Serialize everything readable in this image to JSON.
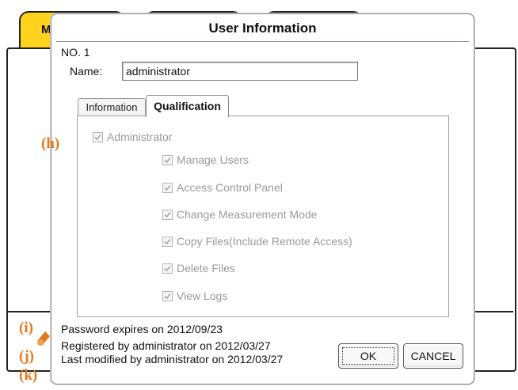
{
  "background": {
    "tabs": [
      {
        "label": "M",
        "color": "#ffd21e"
      },
      {
        "label": "",
        "color": "#c9ed1e"
      },
      {
        "label": "",
        "color": "#ffffff"
      }
    ]
  },
  "markers": {
    "h": "(h)",
    "i": "(i)",
    "j": "(j)",
    "k": "(k)"
  },
  "dialog": {
    "title": "User Information",
    "number_label": "NO. 1",
    "name_label": "Name:",
    "name_value": "administrator",
    "tabs": [
      {
        "label": "Information",
        "active": false
      },
      {
        "label": "Qualification",
        "active": true
      }
    ],
    "permissions": {
      "administrator": {
        "label": "Administrator",
        "checked": true,
        "enabled": false
      },
      "items": [
        {
          "label": "Manage Users",
          "checked": true,
          "enabled": false
        },
        {
          "label": "Access Control Panel",
          "checked": true,
          "enabled": false
        },
        {
          "label": "Change Measurement Mode",
          "checked": true,
          "enabled": false
        },
        {
          "label": "Copy Files(Include Remote Access)",
          "checked": true,
          "enabled": false
        },
        {
          "label": "Delete Files",
          "checked": true,
          "enabled": false
        },
        {
          "label": "View Logs",
          "checked": true,
          "enabled": false
        }
      ]
    },
    "footer": {
      "password_expires": "Password expires on 2012/09/23",
      "registered": "Registered by administrator on 2012/03/27",
      "last_modified": "Last modified by administrator on 2012/03/27"
    },
    "buttons": {
      "ok": "OK",
      "cancel": "CANCEL"
    }
  },
  "colors": {
    "marker": "#e8781e",
    "disabled_text": "#9a9a9a",
    "title_separator": "#7a9aa6"
  }
}
